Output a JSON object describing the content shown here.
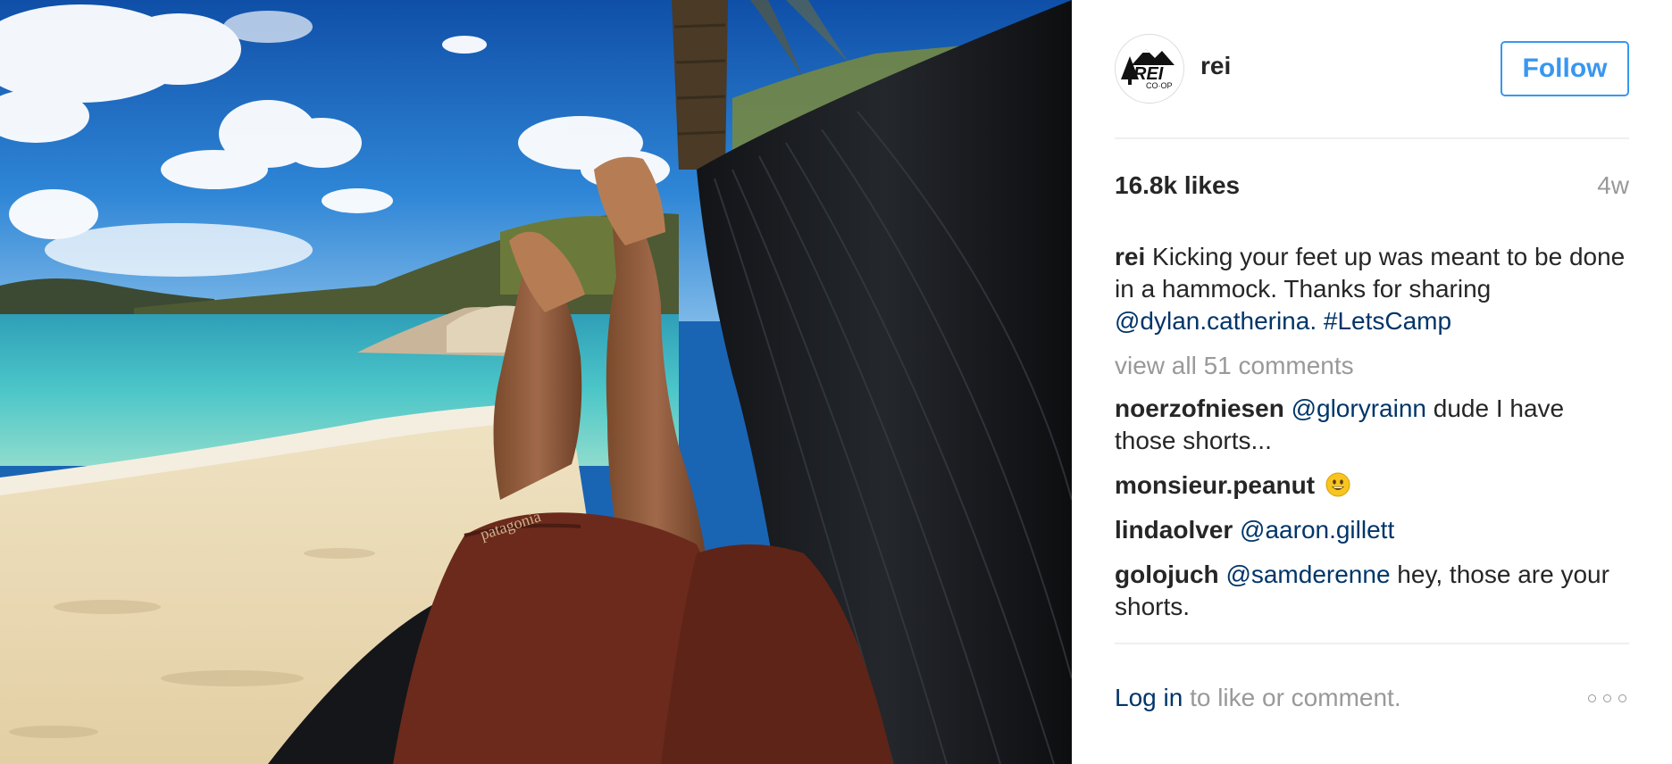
{
  "photo": {
    "alt_label": ""
  },
  "post": {
    "author": "rei",
    "avatar_icon": "rei-coop-logo",
    "follow_label": "Follow",
    "likes": "16.8k likes",
    "time_ago": "4w",
    "caption": {
      "user": "rei",
      "text_1": " Kicking your feet up was meant to be done in a hammock. Thanks for sharing ",
      "mention": "@dylan.catherina.",
      "hashtag_sep": " ",
      "hashtag": "#LetsCamp"
    },
    "view_all": "view all 51 comments",
    "comments": [
      {
        "user": "noerzofniesen",
        "mention": "@gloryrainn",
        "text": " dude I have those shorts..."
      },
      {
        "user": "monsieur.peanut",
        "mention": "",
        "text": "",
        "emoji": "grinning-face-icon"
      },
      {
        "user": "lindaolver",
        "mention": "@aaron.gillett",
        "text": ""
      },
      {
        "user": "golojuch",
        "mention": "@samderenne",
        "text": " hey, those are your shorts."
      }
    ],
    "footer": {
      "login": "Log in",
      "rest": " to like or comment."
    }
  },
  "colors": {
    "follow_blue": "#3897f0",
    "mention_blue": "#003569",
    "muted_gray": "#999999"
  }
}
